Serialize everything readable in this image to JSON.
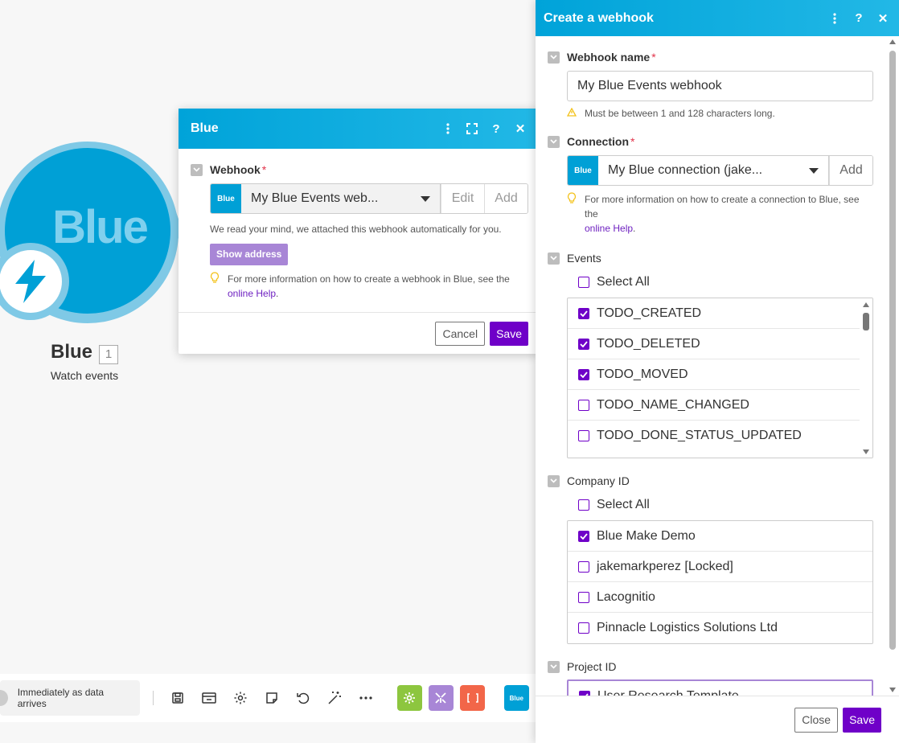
{
  "module": {
    "logo_text": "Blue",
    "title": "Blue",
    "count": "1",
    "subtitle": "Watch events"
  },
  "blue_dialog": {
    "title": "Blue",
    "webhook_label": "Webhook",
    "app_badge": "Blue",
    "webhook_value": "My Blue Events web...",
    "edit_label": "Edit",
    "add_label": "Add",
    "info_text": "We read your mind, we attached this webhook automatically for you.",
    "show_address_label": "Show address",
    "tip_text": "For more information on how to create a webhook in Blue, see the",
    "tip_link": "online Help",
    "tip_end": ".",
    "cancel_label": "Cancel",
    "save_label": "Save"
  },
  "panel": {
    "title": "Create a webhook",
    "webhook_name": {
      "label": "Webhook name",
      "value": "My Blue Events webhook",
      "hint": "Must be between 1 and 128 characters long."
    },
    "connection": {
      "label": "Connection",
      "app_badge": "Blue",
      "value": "My Blue connection (jake...",
      "add_label": "Add",
      "tip_text": "For more information on how to create a connection to Blue, see the",
      "tip_link": "online Help",
      "tip_end": "."
    },
    "events": {
      "label": "Events",
      "select_all": "Select All",
      "items": [
        {
          "label": "TODO_CREATED",
          "checked": true
        },
        {
          "label": "TODO_DELETED",
          "checked": true
        },
        {
          "label": "TODO_MOVED",
          "checked": true
        },
        {
          "label": "TODO_NAME_CHANGED",
          "checked": false
        },
        {
          "label": "TODO_DONE_STATUS_UPDATED",
          "checked": false
        }
      ]
    },
    "company": {
      "label": "Company ID",
      "select_all": "Select All",
      "items": [
        {
          "label": "Blue Make Demo",
          "checked": true
        },
        {
          "label": "jakemarkperez [Locked]",
          "checked": false
        },
        {
          "label": "Lacognitio",
          "checked": false
        },
        {
          "label": "Pinnacle Logistics Solutions Ltd",
          "checked": false
        }
      ]
    },
    "project": {
      "label": "Project ID",
      "items": [
        {
          "label": "User Research Template",
          "checked": true
        }
      ]
    },
    "close_label": "Close",
    "save_label": "Save"
  },
  "toolbar": {
    "schedule_label": "Immediately as data arrives",
    "app_badge": "Blue"
  },
  "colors": {
    "accent": "#00a3d9",
    "purple": "#6f00c8",
    "light_purple": "#a886d6",
    "green_tool": "#8dc63f",
    "purple_tool": "#a886d6",
    "orange_tool": "#f26649"
  }
}
